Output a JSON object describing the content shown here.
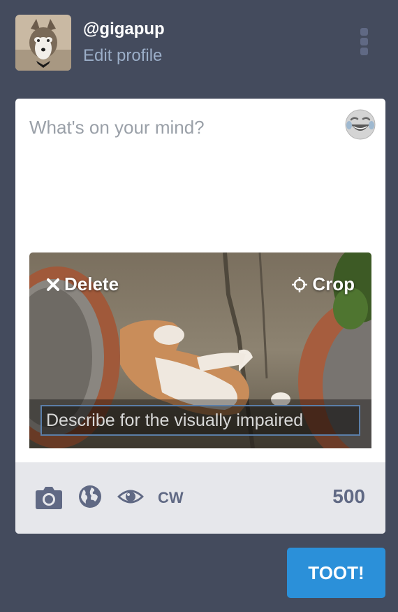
{
  "profile": {
    "username": "@gigapup",
    "edit_label": "Edit profile"
  },
  "compose": {
    "placeholder": "What's on your mind?",
    "media": {
      "delete_label": "Delete",
      "crop_label": "Crop",
      "description_placeholder": "Describe for the visually impaired"
    },
    "toolbar": {
      "cw_label": "CW",
      "char_count": "500"
    },
    "submit_label": "TOOT!"
  },
  "icons": [
    "avatar",
    "menu-icon",
    "emoji-icon",
    "close-icon",
    "crop-icon",
    "camera-icon",
    "globe-icon",
    "eye-icon"
  ],
  "colors": {
    "background": "#444b5d",
    "accent": "#2b90d9",
    "secondary_text": "#9baec8",
    "toolbar_icon": "#606984",
    "toolbar_bg": "#e6e7eb"
  }
}
